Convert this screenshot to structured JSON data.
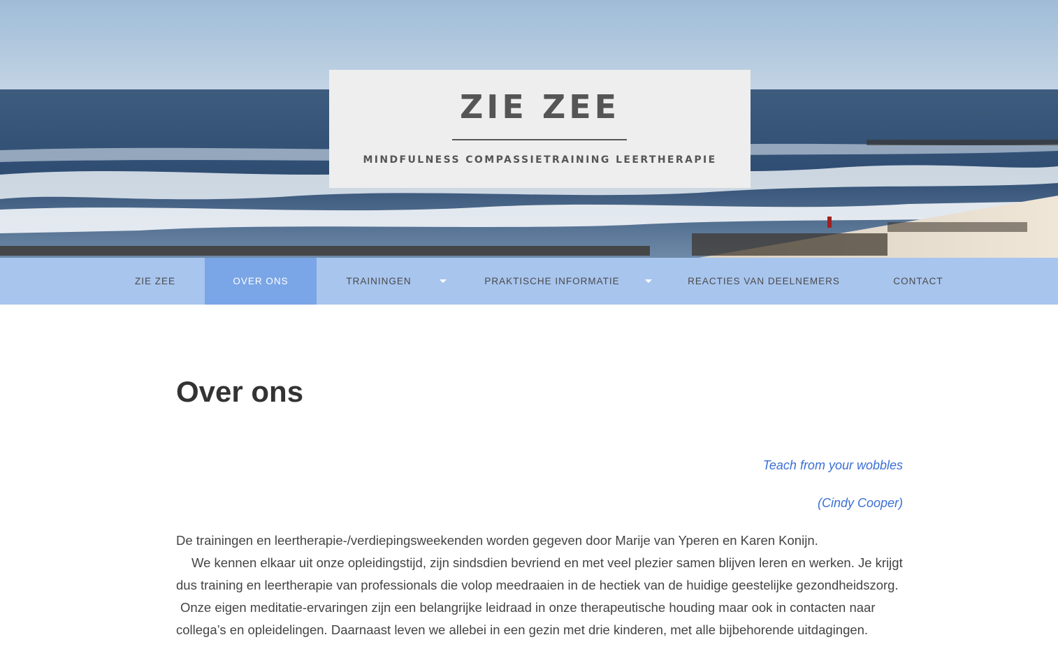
{
  "site": {
    "title": "ZIE ZEE",
    "description": "MINDFULNESS COMPASSIETRAINING LEERTHERAPIE"
  },
  "nav": {
    "items": [
      {
        "label": "ZIE ZEE",
        "has_submenu": false,
        "active": false
      },
      {
        "label": "OVER ONS",
        "has_submenu": false,
        "active": true
      },
      {
        "label": "TRAININGEN",
        "has_submenu": true,
        "active": false
      },
      {
        "label": "PRAKTISCHE INFORMATIE",
        "has_submenu": true,
        "active": false
      },
      {
        "label": "REACTIES VAN DEELNEMERS",
        "has_submenu": false,
        "active": false
      },
      {
        "label": "CONTACT",
        "has_submenu": false,
        "active": false
      }
    ]
  },
  "page": {
    "title": "Over ons",
    "quote": "Teach from your wobbles",
    "quote_author": "(Cindy Cooper)",
    "paragraph_1": "De trainingen en leertherapie-/verdiepingsweekenden worden gegeven door Marije van Yperen en Karen Konijn.",
    "paragraph_2": "We kennen elkaar uit onze opleidingstijd, zijn sindsdien bevriend en met veel plezier samen blijven leren en werken. Je krijgt dus training en leertherapie van professionals die volop meedraaien in de hectiek van de huidige geestelijke gezondheidszorg.",
    "paragraph_3": "Onze eigen meditatie-ervaringen zijn een belangrijke leidraad in onze therapeutische houding maar ook in contacten naar collega’s en opleidelingen. Daarnaast leven we allebei in een gezin met drie kinderen, met alle bijbehorende uitdagingen."
  },
  "colors": {
    "nav_background": "#a8c5ee",
    "nav_active": "#7aa5e6",
    "quote_text": "#3b6fd4",
    "brand_box": "#eeeeee"
  }
}
